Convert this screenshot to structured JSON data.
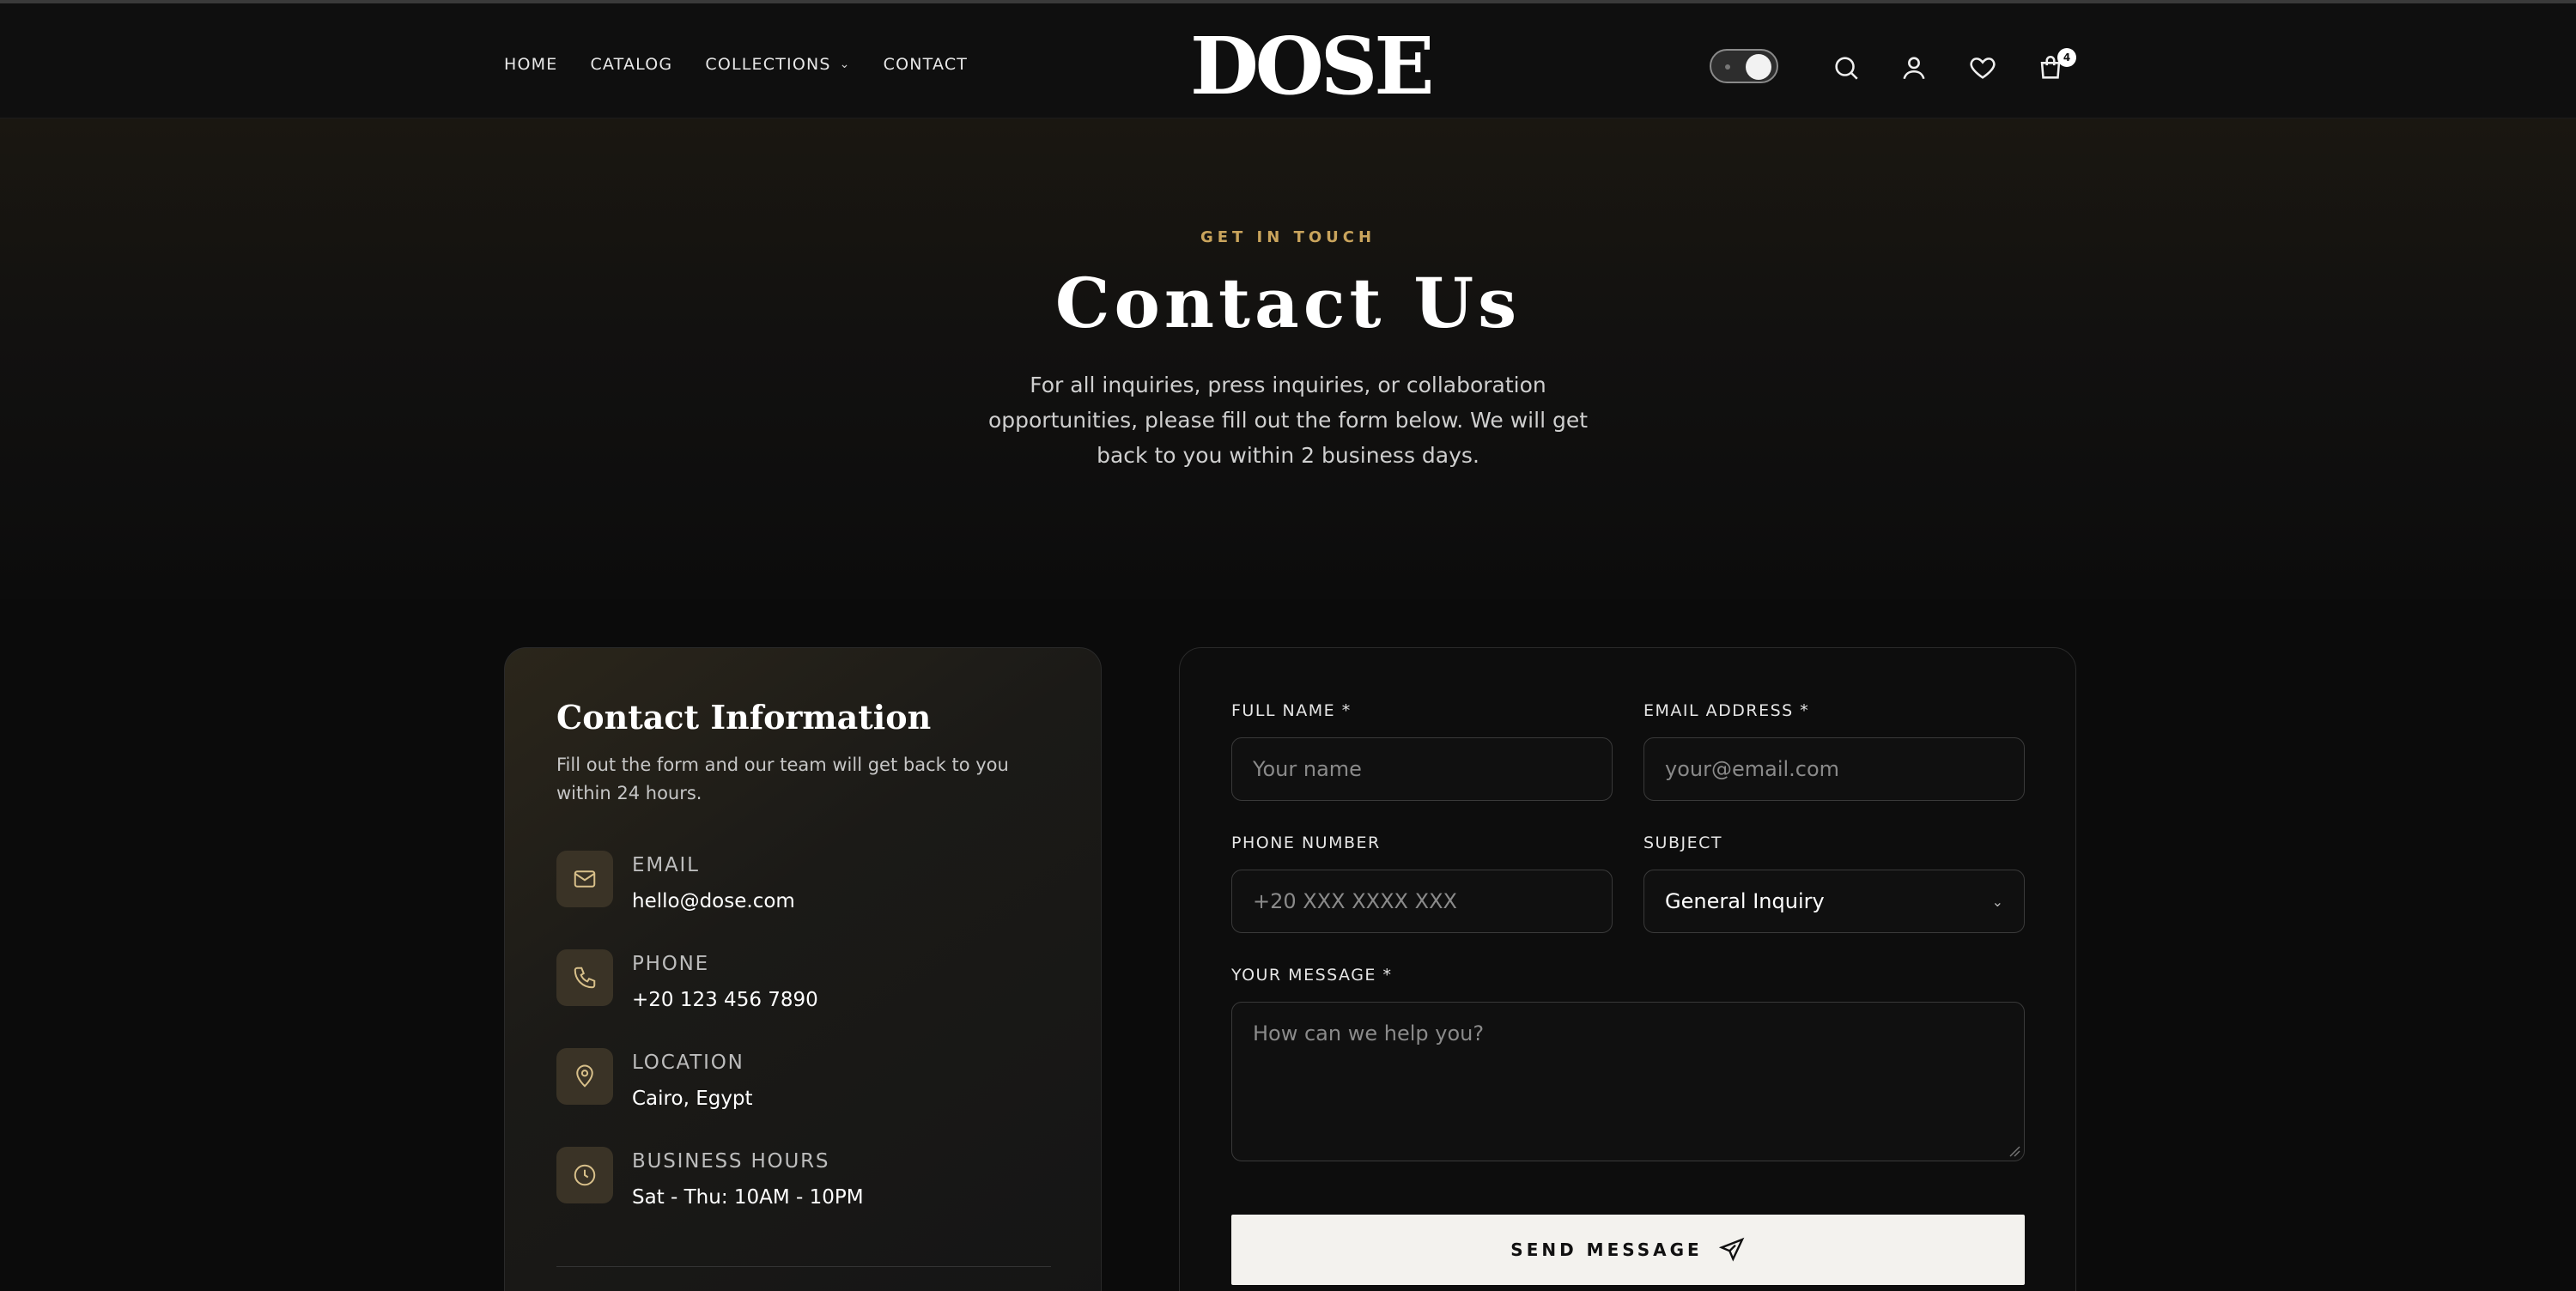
{
  "header": {
    "nav": [
      {
        "label": "HOME"
      },
      {
        "label": "CATALOG"
      },
      {
        "label": "COLLECTIONS"
      },
      {
        "label": "CONTACT"
      }
    ],
    "logo_text": "DOSE",
    "cart_count": "4",
    "icons": [
      "theme-toggle",
      "search-icon",
      "user-icon",
      "heart-icon",
      "cart-icon"
    ]
  },
  "hero": {
    "eyebrow": "GET IN TOUCH",
    "title": "Contact Us",
    "subtitle": "For all inquiries, press inquiries, or collaboration opportunities, please fill out the form below. We will get back to you within 2 business days."
  },
  "info": {
    "title": "Contact Information",
    "subtitle": "Fill out the form and our team will get back to you within 24 hours.",
    "items": [
      {
        "icon": "mail-icon",
        "label": "EMAIL",
        "value": "hello@dose.com"
      },
      {
        "icon": "phone-icon",
        "label": "PHONE",
        "value": "+20 123 456 7890"
      },
      {
        "icon": "location-pin-icon",
        "label": "LOCATION",
        "value": "Cairo, Egypt"
      },
      {
        "icon": "clock-icon",
        "label": "BUSINESS HOURS",
        "value": "Sat - Thu: 10AM - 10PM"
      }
    ]
  },
  "form": {
    "full_name": {
      "label": "FULL NAME *",
      "placeholder": "Your name"
    },
    "email": {
      "label": "EMAIL ADDRESS *",
      "placeholder": "your@email.com"
    },
    "phone": {
      "label": "PHONE NUMBER",
      "placeholder": "+20 XXX XXXX XXX"
    },
    "subject": {
      "label": "SUBJECT",
      "value": "General Inquiry"
    },
    "message": {
      "label": "YOUR MESSAGE *",
      "placeholder": "How can we help you?"
    },
    "submit_label": "SEND MESSAGE"
  },
  "colors": {
    "accent_gold": "#c9a45c",
    "background": "#0b0b0b",
    "button_bg": "#f3f2ee"
  }
}
